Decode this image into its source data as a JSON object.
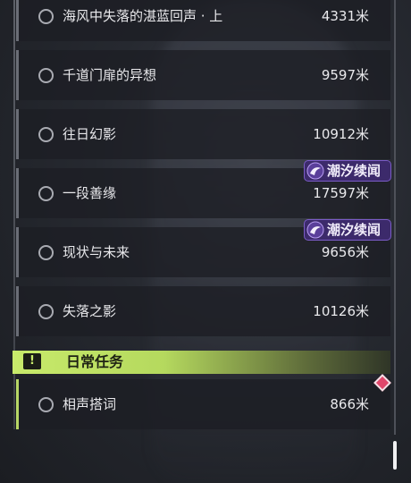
{
  "quests": [
    {
      "name": "海风中失落的湛蓝回声 · 上",
      "distance": "4331米"
    },
    {
      "name": "千道门扉的异想",
      "distance": "9597米"
    },
    {
      "name": "往日幻影",
      "distance": "10912米"
    },
    {
      "name": "一段善缘",
      "distance": "17597米",
      "tag": "潮汐续闻"
    },
    {
      "name": "现状与未来",
      "distance": "9656米",
      "tag": "潮汐续闻"
    },
    {
      "name": "失落之影",
      "distance": "10126米"
    }
  ],
  "daily_section": {
    "icon": "exclamation-icon",
    "title": "日常任务",
    "accent_color": "#c8ea6b",
    "quests": [
      {
        "name": "相声搭词",
        "distance": "866米"
      }
    ]
  },
  "colors": {
    "tag_background": "#3c2a6b",
    "tag_border": "#7a5bc6",
    "tracked_marker": "#e0476b"
  }
}
